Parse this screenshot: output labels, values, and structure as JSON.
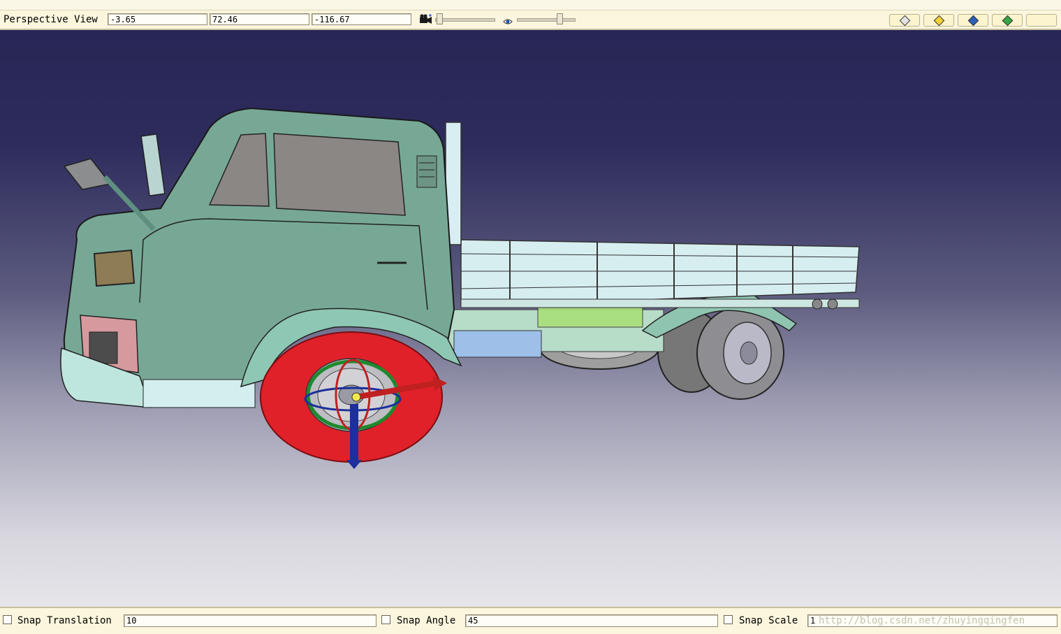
{
  "toolbar": {
    "view_mode": "Perspective View",
    "coord_x": "-3.65",
    "coord_y": "72.46",
    "coord_z": "-116.67",
    "camera_icon": "camera-icon",
    "eye_icon": "eye-icon",
    "view_buttons": [
      "wireframe-view-icon",
      "shaded-view-icon",
      "solid-view-icon",
      "colored-view-icon"
    ]
  },
  "viewport": {
    "background_top": "#272655",
    "background_bottom": "#e6e5ea",
    "model": "truck",
    "selected_part_color": "#e0212a",
    "gizmo_colors": {
      "x": "#c02020",
      "y": "#1c2f9a",
      "z": "#1e8a2e"
    }
  },
  "status": {
    "snap_translation_label": "Snap Translation",
    "snap_translation_value": "10",
    "snap_angle_label": "Snap Angle",
    "snap_angle_value": "45",
    "snap_scale_label": "Snap Scale",
    "snap_scale_value": "1",
    "watermark": "http://blog.csdn.net/zhuyingqingfen"
  }
}
